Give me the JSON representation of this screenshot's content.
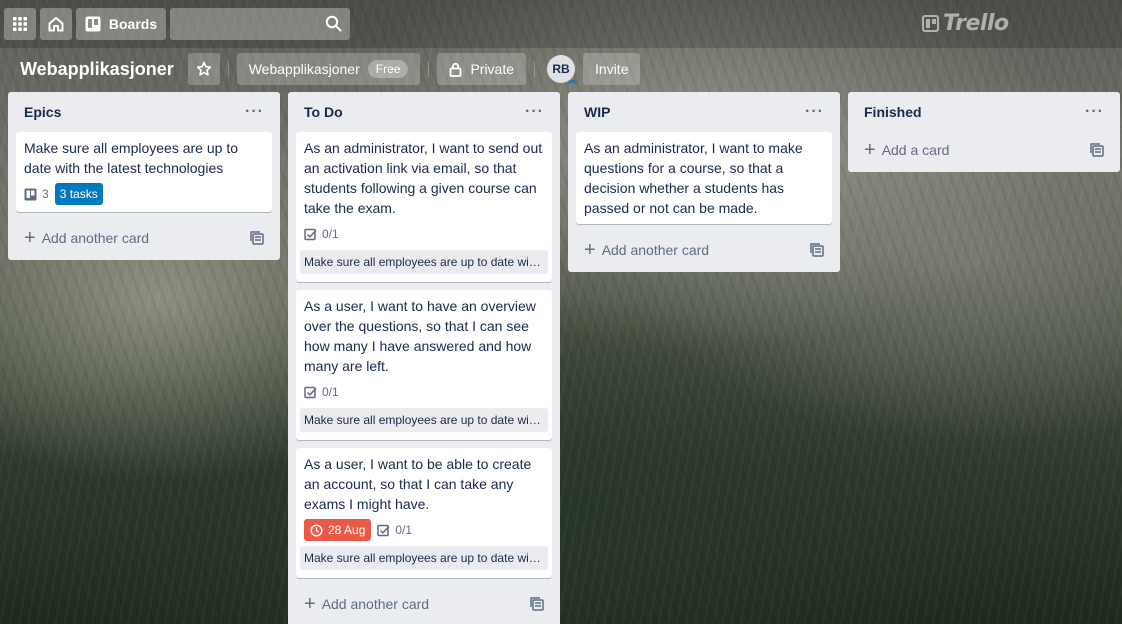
{
  "topbar": {
    "boards_label": "Boards",
    "search": {
      "value": "",
      "placeholder": ""
    },
    "logo_text": "Trello"
  },
  "board": {
    "title": "Webapplikasjoner",
    "team_label": "Webapplikasjoner",
    "plan_badge": "Free",
    "visibility_label": "Private",
    "member_initials": "RB",
    "invite_label": "Invite"
  },
  "lists": [
    {
      "title": "Epics",
      "add_label": "Add another card",
      "cards": [
        {
          "title": "Make sure all employees are up to date with the latest technologies",
          "attachments": "3",
          "tasks_label": "3 tasks"
        }
      ]
    },
    {
      "title": "To Do",
      "add_label": "Add another card",
      "cards": [
        {
          "title": "As an administrator, I want to send out an activation link via email, so that students following a given course can take the exam.",
          "checklist": "0/1",
          "epic": "Make sure all employees are up to date with the latest technologies"
        },
        {
          "title": "As a user, I want to have an overview over the questions, so that I can see how many I have answered and how many are left.",
          "checklist": "0/1",
          "epic": "Make sure all employees are up to date with the latest technologies"
        },
        {
          "title": "As a user, I want to be able to create an account, so that I can take any exams I might have.",
          "due": "28 Aug",
          "checklist": "0/1",
          "epic": "Make sure all employees are up to date with the latest technologies"
        }
      ]
    },
    {
      "title": "WIP",
      "add_label": "Add another card",
      "cards": [
        {
          "title": "As an administrator, I want to make questions for a course, so that a decision whether a students has passed or not can be made."
        }
      ]
    },
    {
      "title": "Finished",
      "add_label": "Add a card",
      "cards": []
    }
  ],
  "colors": {
    "label_blue": "#0079bf",
    "due_overdue": "#eb5a46",
    "list_bg": "#ebecf0"
  }
}
